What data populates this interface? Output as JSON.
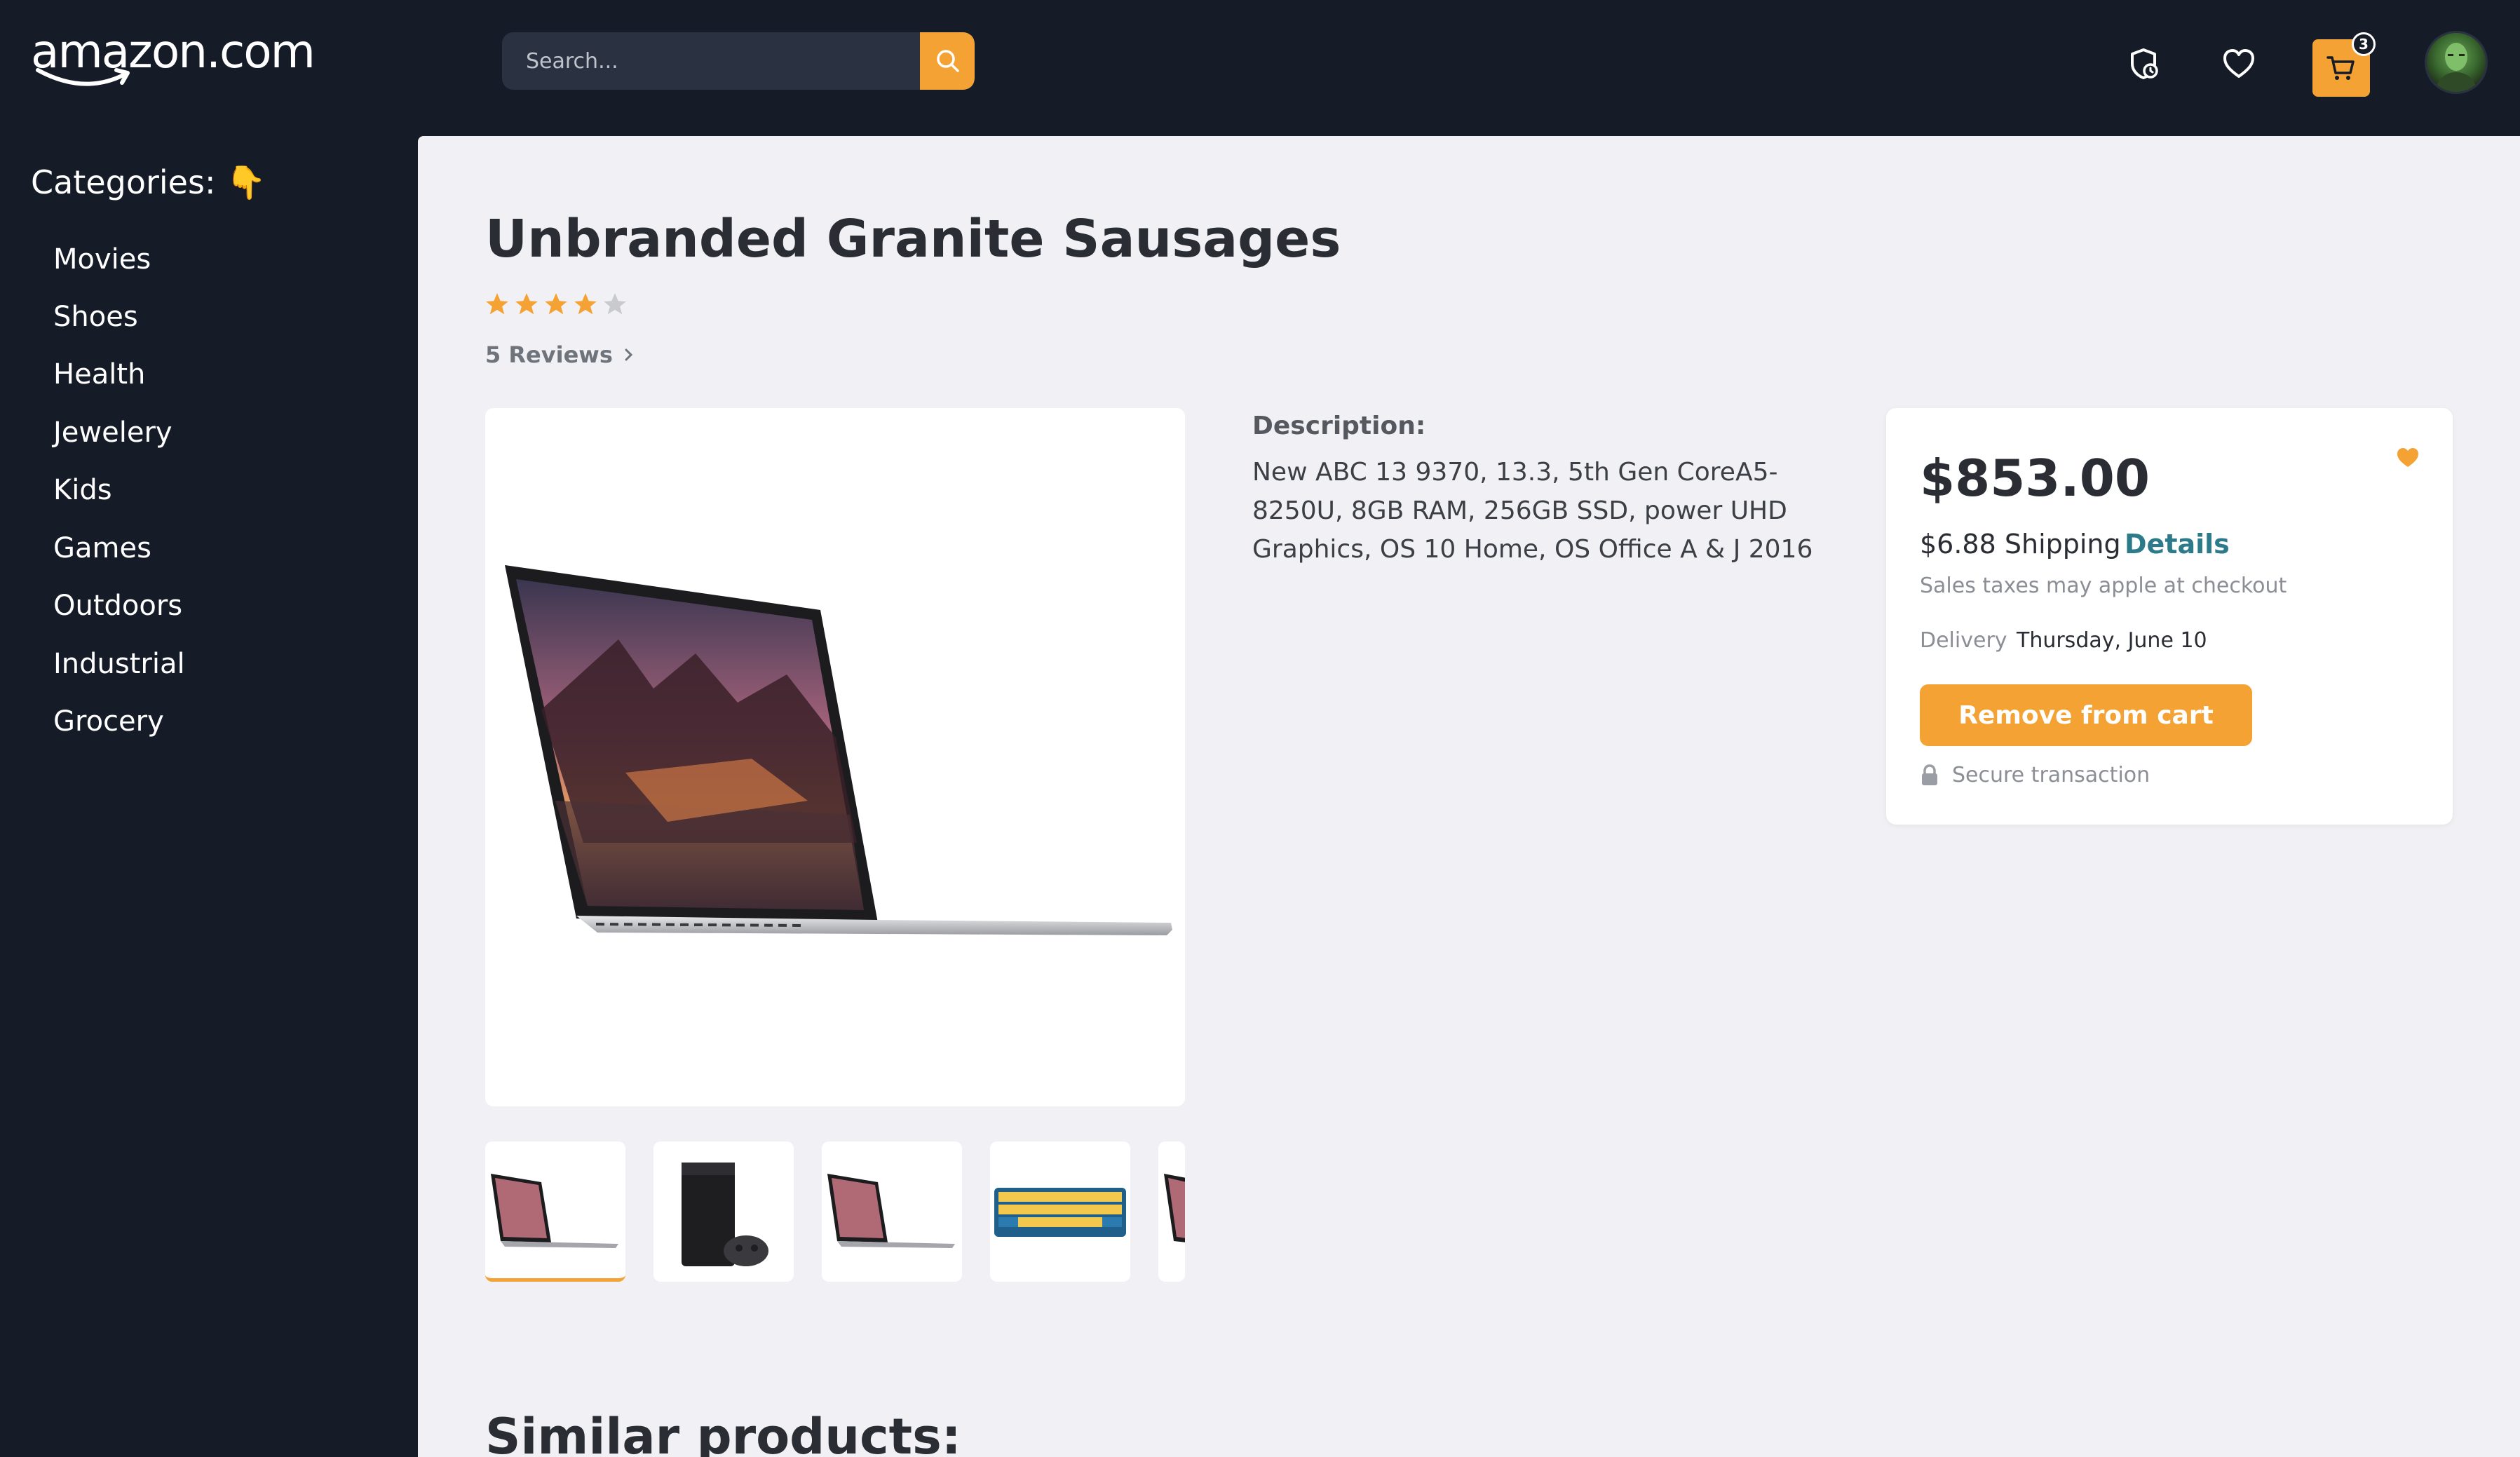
{
  "header": {
    "logo_text": "amazon.com",
    "search": {
      "placeholder": "Search...",
      "value": ""
    },
    "icons": [
      "order-history-icon",
      "heart-icon",
      "cart-icon",
      "user-avatar"
    ],
    "cart_count": "3"
  },
  "sidebar": {
    "title": "Categories: 👇",
    "items": [
      {
        "label": "Movies"
      },
      {
        "label": "Shoes"
      },
      {
        "label": "Health"
      },
      {
        "label": "Jewelery"
      },
      {
        "label": "Kids"
      },
      {
        "label": "Games"
      },
      {
        "label": "Outdoors"
      },
      {
        "label": "Industrial"
      },
      {
        "label": "Grocery"
      }
    ]
  },
  "product": {
    "title": "Unbranded Granite Sausages",
    "rating": 4,
    "rating_max": 5,
    "reviews_label": "5 Reviews",
    "description_label": "Description:",
    "description": "New ABC 13 9370, 13.3, 5th Gen CoreA5-8250U, 8GB RAM, 256GB SSD, power UHD Graphics, OS 10 Home, OS Office A & J 2016",
    "thumbnails": [
      "laptop",
      "game-console",
      "laptop",
      "keyboard",
      "laptop"
    ],
    "active_thumbnail": 0
  },
  "purchase": {
    "price": "$853.00",
    "shipping": "$6.88 Shipping",
    "details_link": "Details",
    "tax_note": "Sales taxes may apple at checkout",
    "delivery_label": "Delivery",
    "delivery_date": "Thursday, June 10",
    "action_button": "Remove from cart",
    "secure_note": "Secure transaction"
  },
  "similar_title": "Similar products:",
  "colors": {
    "background": "#151c28",
    "content": "#f1f1f5",
    "accent": "#f3a233",
    "link": "#2d7a8a"
  }
}
